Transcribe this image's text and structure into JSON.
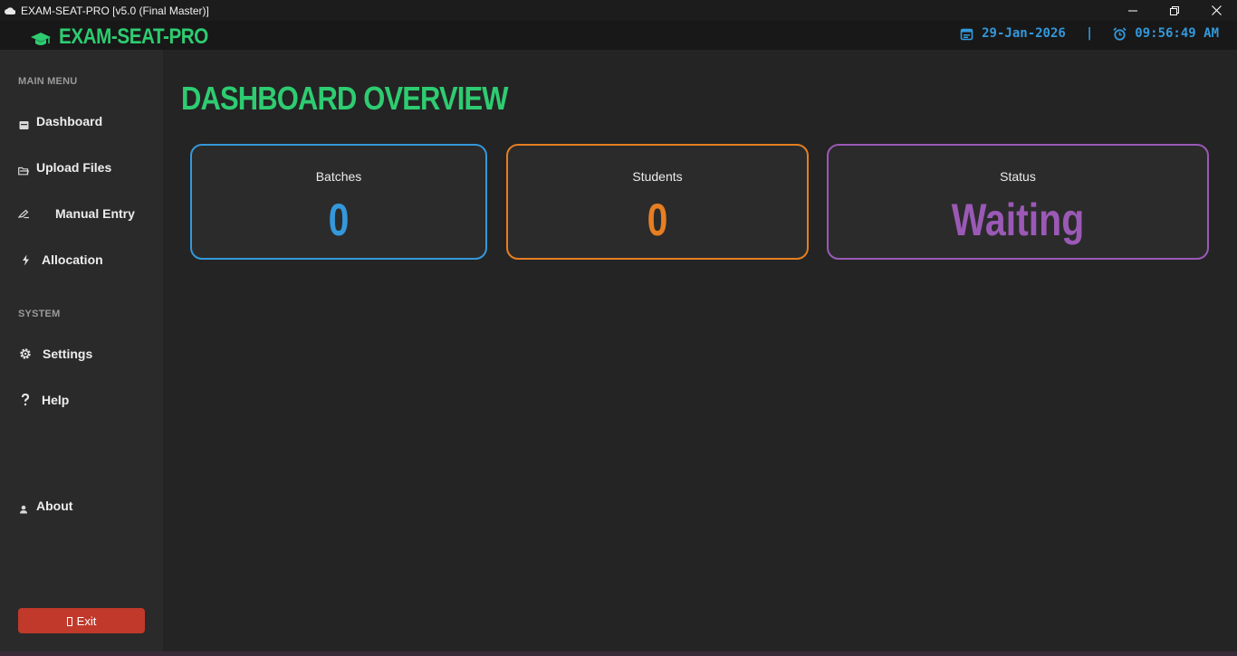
{
  "window": {
    "title": "EXAM-SEAT-PRO [v5.0 (Final Master)]",
    "controls": [
      "minimize-icon",
      "restore-icon",
      "close-icon"
    ]
  },
  "header": {
    "brand": "EXAM-SEAT-PRO",
    "brand_icon": "graduation-cap-icon",
    "date": "29-Jan-2026",
    "separator": "|",
    "time": "09:56:49 AM",
    "date_icon": "calendar-icon",
    "time_icon": "alarm-clock-icon"
  },
  "sidebar": {
    "main_menu_label": "MAIN MENU",
    "main_items": [
      {
        "label": "Dashboard",
        "icon": "dashboard-icon"
      },
      {
        "label": "Upload Files",
        "icon": "folder-icon"
      },
      {
        "label": "Manual Entry",
        "icon": "edit-icon"
      },
      {
        "label": "Allocation",
        "icon": "lightning-icon"
      }
    ],
    "system_label": "SYSTEM",
    "system_items": [
      {
        "label": "Settings",
        "icon": "gear-icon"
      },
      {
        "label": "Help",
        "icon": "question-icon"
      }
    ],
    "about": {
      "label": "About",
      "icon": "user-icon"
    },
    "exit": {
      "label": "Exit",
      "icon": "exit-icon"
    }
  },
  "main": {
    "title": "DASHBOARD OVERVIEW",
    "cards": [
      {
        "label": "Batches",
        "value": "0",
        "color": "#3498db"
      },
      {
        "label": "Students",
        "value": "0",
        "color": "#e67e22"
      },
      {
        "label": "Status",
        "value": "Waiting",
        "color": "#9b59b6"
      }
    ]
  },
  "colors": {
    "accent": "#2ecc71",
    "clock": "#3498db",
    "exit": "#c0392b"
  }
}
